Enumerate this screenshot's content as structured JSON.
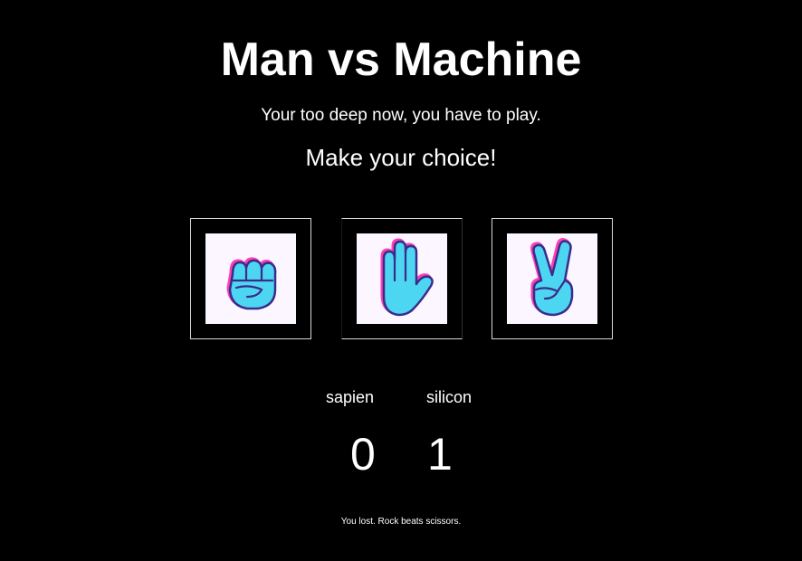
{
  "header": {
    "title": "Man vs Machine",
    "subtitle": "Your too deep now, you have to play.",
    "prompt": "Make your choice!"
  },
  "choices": [
    {
      "id": "rock",
      "icon": "fist-hand-icon"
    },
    {
      "id": "paper",
      "icon": "open-hand-icon"
    },
    {
      "id": "scissors",
      "icon": "victory-hand-icon"
    }
  ],
  "scoreboard": {
    "human_label": "sapien",
    "machine_label": "silicon",
    "human_score": "0",
    "machine_score": "1"
  },
  "result": {
    "message": "You lost. Rock beats scissors."
  },
  "colors": {
    "background": "#000000",
    "text": "#ffffff",
    "hand_fill": "#4dd6f2",
    "hand_outline": "#3a2c8a",
    "hand_shadow": "#ff3fb2",
    "tile_background": "#fbf6ff"
  }
}
